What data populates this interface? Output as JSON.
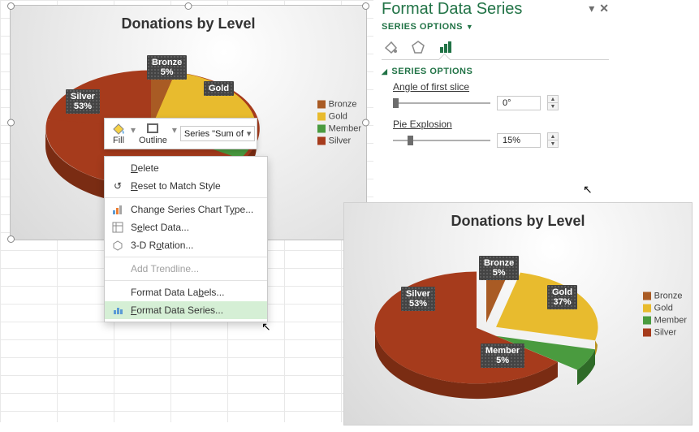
{
  "chart_data": {
    "type": "pie",
    "title": "Donations by Level",
    "series_name": "Sum of",
    "categories": [
      "Bronze",
      "Gold",
      "Member",
      "Silver"
    ],
    "values": [
      5,
      37,
      5,
      53
    ],
    "colors": {
      "Bronze": "#a95b24",
      "Gold": "#e8bb2e",
      "Member": "#4a9b3f",
      "Silver": "#a63b1c"
    },
    "explosion_pct": 15,
    "first_slice_angle": 0
  },
  "chart1": {
    "title": "Donations by Level",
    "labels": {
      "bronze": {
        "name": "Bronze",
        "pct": "5%"
      },
      "gold": {
        "name": "Gold"
      },
      "silver": {
        "name": "Silver",
        "pct": "53%"
      }
    }
  },
  "chart2": {
    "title": "Donations by Level",
    "labels": {
      "bronze": {
        "name": "Bronze",
        "pct": "5%"
      },
      "gold": {
        "name": "Gold",
        "pct": "37%"
      },
      "member": {
        "name": "Member",
        "pct": "5%"
      },
      "silver": {
        "name": "Silver",
        "pct": "53%"
      }
    }
  },
  "legend": {
    "bronze": "Bronze",
    "gold": "Gold",
    "member": "Member",
    "silver": "Silver"
  },
  "colors": {
    "bronze": "#a95b24",
    "gold": "#e8bb2e",
    "member": "#4a9b3f",
    "silver": "#a63b1c",
    "accent": "#217346"
  },
  "mini_toolbar": {
    "fill": "Fill",
    "outline": "Outline",
    "series_selector": "Series \"Sum of"
  },
  "context_menu": {
    "delete": "Delete",
    "reset": "Reset to Match Style",
    "change": "Change Series Chart Type...",
    "select_data": "Select Data...",
    "rotation": "3-D Rotation...",
    "trendline": "Add Trendline...",
    "data_labels": "Format Data Labels...",
    "data_series": "Format Data Series..."
  },
  "panel": {
    "title": "Format Data Series",
    "series_options_link": "SERIES OPTIONS",
    "section": "SERIES OPTIONS",
    "angle_label": "Angle of first slice",
    "angle_value": "0°",
    "explosion_label": "Pie Explosion",
    "explosion_value": "15%"
  }
}
